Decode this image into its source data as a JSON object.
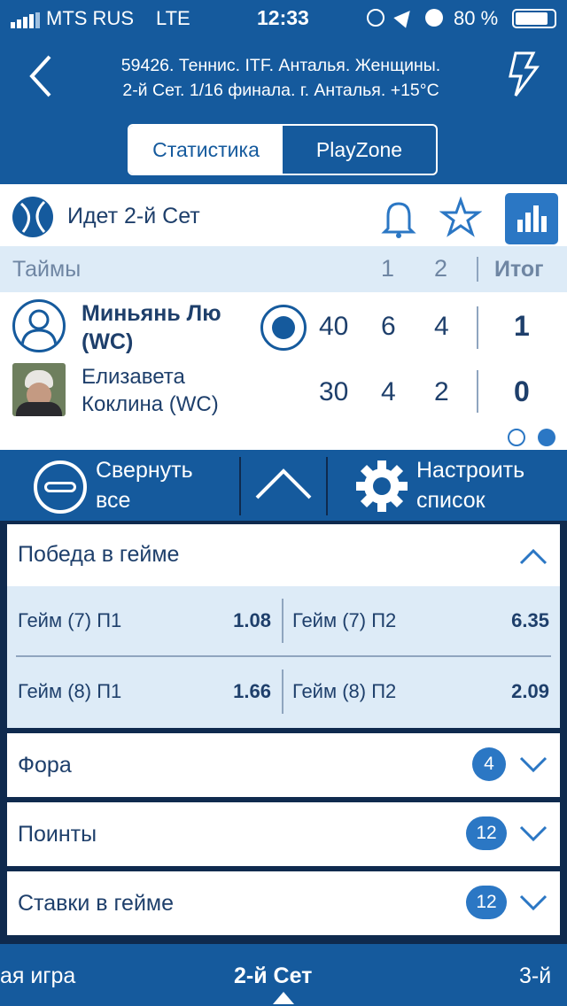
{
  "status": {
    "carrier": "MTS RUS",
    "network": "LTE",
    "time": "12:33",
    "battery": "80 %"
  },
  "header": {
    "line1": "59426. Теннис. ITF. Анталья. Женщины.",
    "line2": "2-й  Сет. 1/16 финала. г. Анталья. +15°С"
  },
  "tabs": [
    {
      "label": "Статистика",
      "active": true
    },
    {
      "label": "PlayZone",
      "active": false
    }
  ],
  "match": {
    "status": "Идет 2-й  Сет",
    "columns_label": "Таймы",
    "set_headers": [
      "1",
      "2"
    ],
    "total_header": "Итог",
    "players": [
      {
        "name_line1": "Миньянь Лю",
        "name_line2": "(WC)",
        "points": "40",
        "sets": [
          "6",
          "4"
        ],
        "total": "1",
        "serving": true
      },
      {
        "name_line1": "Елизавета",
        "name_line2": "Коклина (WC)",
        "points": "30",
        "sets": [
          "4",
          "2"
        ],
        "total": "0",
        "serving": false
      }
    ]
  },
  "toolbar": {
    "collapse_line1": "Свернуть",
    "collapse_line2": "все",
    "configure_line1": "Настроить",
    "configure_line2": "список"
  },
  "markets": [
    {
      "title": "Победа в гейме",
      "expanded": true,
      "rows": [
        [
          {
            "label": "Гейм (7) П1",
            "odd": "1.08"
          },
          {
            "label": "Гейм (7) П2",
            "odd": "6.35"
          }
        ],
        [
          {
            "label": "Гейм (8) П1",
            "odd": "1.66"
          },
          {
            "label": "Гейм (8) П2",
            "odd": "2.09"
          }
        ]
      ]
    },
    {
      "title": "Фора",
      "count": "4",
      "expanded": false
    },
    {
      "title": "Поинты",
      "count": "12",
      "expanded": false
    },
    {
      "title": "Ставки в гейме",
      "count": "12",
      "expanded": false
    }
  ],
  "bottom_tabs": {
    "left": "ая игра",
    "center": "2-й  Сет",
    "right": "3-й"
  },
  "colors": {
    "primary": "#155a9d",
    "dark": "#0f2a4e",
    "accent": "#2b77c4",
    "light": "#ddebf7"
  }
}
